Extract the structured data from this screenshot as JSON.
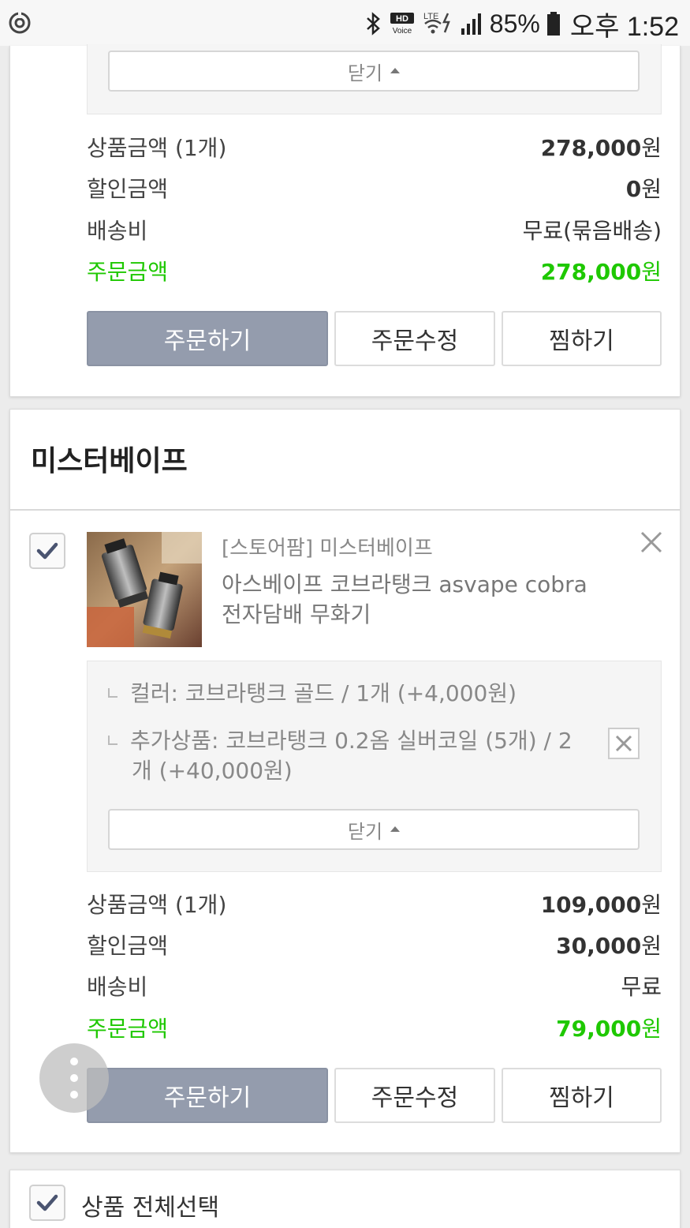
{
  "status_bar": {
    "battery": "85%",
    "time": "오후 1:52",
    "hd_top": "HD",
    "hd_bottom": "Voice",
    "lte": "LTE"
  },
  "card1": {
    "close_label": "닫기",
    "summary": {
      "product_amount_label": "상품금액 (1개)",
      "product_amount": "278,000",
      "discount_label": "할인금액",
      "discount": "0",
      "shipping_label": "배송비",
      "shipping": "무료(묶음배송)",
      "order_amount_label": "주문금액",
      "order_amount": "278,000",
      "currency": "원"
    },
    "buttons": {
      "order": "주문하기",
      "edit": "주문수정",
      "wish": "찜하기"
    }
  },
  "card2": {
    "store_name": "미스터베이프",
    "item": {
      "store_label": "[스토어팜] 미스터베이프",
      "name_line1": "아스베이프 코브라탱크 asvape cobra",
      "name_line2": "전자담배 무화기",
      "checked": true
    },
    "options": {
      "color_option": "컬러: 코브라탱크 골드 / 1개 (+4,000원)",
      "addon_line1": "추가상품: 코브라탱크 0.2옴 실버코일 (5개) / 2",
      "addon_line2": "개 (+40,000원)",
      "close_label": "닫기"
    },
    "summary": {
      "product_amount_label": "상품금액 (1개)",
      "product_amount": "109,000",
      "discount_label": "할인금액",
      "discount": "30,000",
      "shipping_label": "배송비",
      "shipping": "무료",
      "order_amount_label": "주문금액",
      "order_amount": "79,000",
      "currency": "원"
    },
    "buttons": {
      "order": "주문하기",
      "edit": "주문수정",
      "wish": "찜하기"
    }
  },
  "footer": {
    "select_all_label": "상품 전체선택",
    "checked": true
  },
  "colors": {
    "accent_green": "#1ec800",
    "primary_button": "#949cad"
  }
}
